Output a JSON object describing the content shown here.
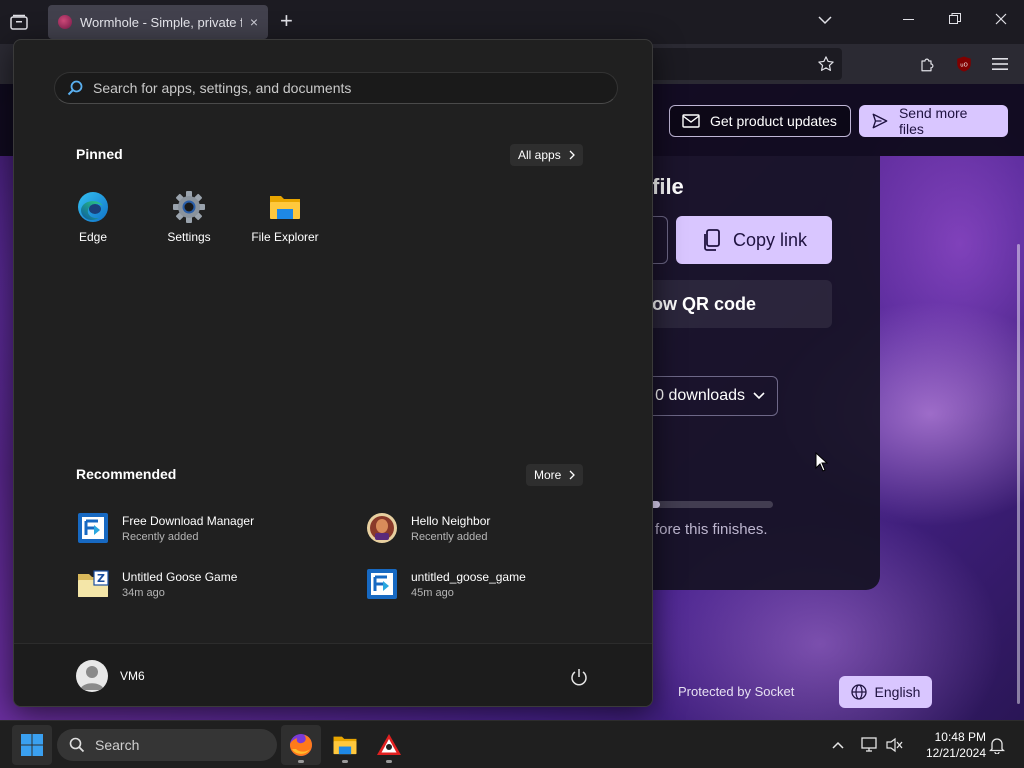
{
  "browser": {
    "tab_title": "Wormhole - Simple, private file",
    "new_tab": "+",
    "tab_close": "×"
  },
  "page": {
    "get_updates": "Get product updates",
    "send_more": "Send more files",
    "card_title": "file",
    "copy_link": "Copy link",
    "show_qr": "ow QR code",
    "downloads": "0 downloads",
    "upload_progress": 0.15,
    "info": "fore this finishes.",
    "protected": "Protected by Socket",
    "language": "English"
  },
  "start_menu": {
    "search_placeholder": "Search for apps, settings, and documents",
    "pinned_title": "Pinned",
    "all_apps": "All apps",
    "pinned": [
      {
        "label": "Edge",
        "icon": "edge-icon"
      },
      {
        "label": "Settings",
        "icon": "settings-gear-icon"
      },
      {
        "label": "File Explorer",
        "icon": "file-explorer-icon"
      }
    ],
    "recommended_title": "Recommended",
    "more": "More",
    "recommended": [
      {
        "name": "Free Download Manager",
        "sub": "Recently added",
        "icon": "free-download-manager-icon"
      },
      {
        "name": "Hello Neighbor",
        "sub": "Recently added",
        "icon": "hello-neighbor-icon"
      },
      {
        "name": "Untitled Goose Game",
        "sub": "34m ago",
        "icon": "zip-folder-icon"
      },
      {
        "name": "untitled_goose_game",
        "sub": "45m ago",
        "icon": "free-download-manager-icon"
      }
    ],
    "user_name": "VM6"
  },
  "taskbar": {
    "search_label": "Search",
    "time": "10:48 PM",
    "date": "12/21/2024"
  },
  "colors": {
    "accent_button": "#d9c6ff",
    "start_bg": "#202020",
    "taskbar_bg": "#1f1f1f",
    "windows_blue": "#3aa0f0"
  }
}
